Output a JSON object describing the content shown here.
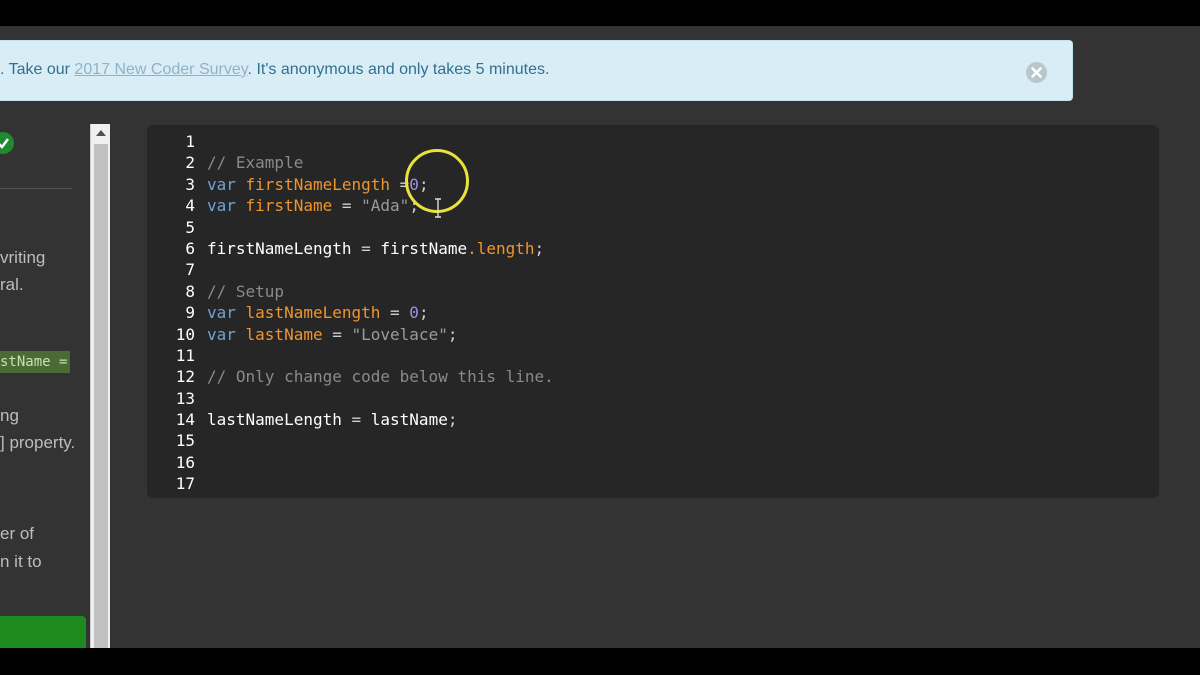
{
  "banner": {
    "text_before": ". Take our ",
    "link_text": "2017 New Coder Survey",
    "text_after": ". It's anonymous and only takes 5 minutes.",
    "close_icon": "close-circle-icon"
  },
  "left_panel": {
    "check_icon": "checkmark-icon",
    "lines": [
      "vriting",
      "ral.",
      "ng",
      "] property.",
      "er of",
      "n it to"
    ],
    "code_snippet": "stName ="
  },
  "editor": {
    "line_numbers": [
      "1",
      "2",
      "3",
      "4",
      "5",
      "6",
      "7",
      "8",
      "9",
      "10",
      "11",
      "12",
      "13",
      "14",
      "15",
      "16",
      "17"
    ],
    "lines": [
      [],
      [
        {
          "t": "// Example",
          "c": "cmt"
        }
      ],
      [
        {
          "t": "var ",
          "c": "kw"
        },
        {
          "t": "firstNameLength",
          "c": "vn"
        },
        {
          "t": " =",
          "c": "pn"
        },
        {
          "t": "0",
          "c": "num"
        },
        {
          "t": ";",
          "c": "pn"
        }
      ],
      [
        {
          "t": "var ",
          "c": "kw"
        },
        {
          "t": "firstName",
          "c": "vn"
        },
        {
          "t": " = ",
          "c": "pn"
        },
        {
          "t": "\"Ada\"",
          "c": "str"
        },
        {
          "t": ";",
          "c": "pn"
        }
      ],
      [],
      [
        {
          "t": "firstNameLength",
          "c": "pl"
        },
        {
          "t": " = ",
          "c": "pn"
        },
        {
          "t": "firstName",
          "c": "pl"
        },
        {
          "t": ".length",
          "c": "prop"
        },
        {
          "t": ";",
          "c": "pn"
        }
      ],
      [],
      [
        {
          "t": "// Setup",
          "c": "cmt"
        }
      ],
      [
        {
          "t": "var ",
          "c": "kw"
        },
        {
          "t": "lastNameLength",
          "c": "vn"
        },
        {
          "t": " = ",
          "c": "pn"
        },
        {
          "t": "0",
          "c": "num"
        },
        {
          "t": ";",
          "c": "pn"
        }
      ],
      [
        {
          "t": "var ",
          "c": "kw"
        },
        {
          "t": "lastName",
          "c": "vn"
        },
        {
          "t": " = ",
          "c": "pn"
        },
        {
          "t": "\"Lovelace\"",
          "c": "str"
        },
        {
          "t": ";",
          "c": "pn"
        }
      ],
      [],
      [
        {
          "t": "// Only change code below this line.",
          "c": "cmt"
        }
      ],
      [],
      [
        {
          "t": "lastNameLength",
          "c": "pl"
        },
        {
          "t": " = ",
          "c": "pn"
        },
        {
          "t": "lastName",
          "c": "pl"
        },
        {
          "t": ";",
          "c": "pn"
        }
      ],
      [],
      [],
      []
    ]
  },
  "colors": {
    "editor_bg": "#262626",
    "keyword": "#70a3d3",
    "variable": "#f0952e",
    "number": "#a78be3",
    "comment": "#8a8a8a",
    "banner_bg": "#d9edf7",
    "cursor_highlight": "#e8e23a"
  }
}
